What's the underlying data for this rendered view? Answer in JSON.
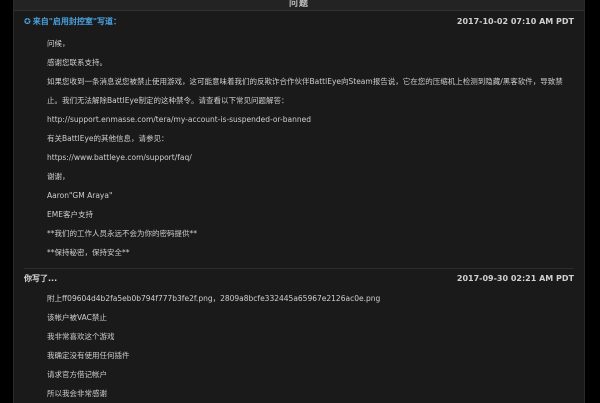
{
  "window": {
    "title": "问题"
  },
  "messages": [
    {
      "author": "来自\"启用封控室\"写道：",
      "timestamp": "2017-10-02 07:10 AM PDT",
      "lines": [
        "问候，",
        "感谢您联系支持。",
        "如果您收到一条消息说您被禁止使用游戏，这可能意味着我们的反欺诈合作伙伴BattlEye向Steam报告说，它在您的压缩机上检测到隐藏/黑客软件，导致禁",
        "止。我们无法解除BattlEye制定的这种禁令。请查看以下常见问题解答：",
        "http://support.enmasse.com/tera/my-account-is-suspended-or-banned",
        "有关BattlEye的其他信息，请参见：",
        "https://www.battleye.com/support/faq/",
        "谢谢，",
        "Aaron\"GM Araya\"",
        "EME客户支持",
        "**我们的工作人员永远不会为你的密码提供**",
        "**保持秘密，保持安全**"
      ]
    },
    {
      "author": "你写了...",
      "timestamp": "2017-09-30 02:21 AM PDT",
      "lines": [
        "附上ff09604d4b2fa5eb0b794f777b3fe2f.png，2809a8bcfe332445a65967e2126ac0e.png",
        "该帐户被VAC禁止",
        "我非常喜欢这个游戏",
        "我确定没有使用任何插件",
        "请求官方借记帐户",
        "所以我会非常感谢"
      ]
    }
  ]
}
